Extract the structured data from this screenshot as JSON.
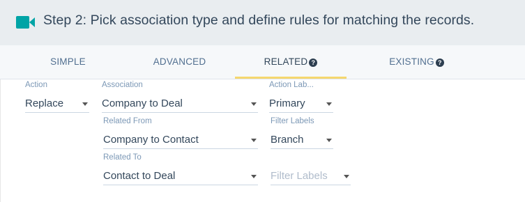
{
  "header": {
    "title": "Step 2: Pick association type and define rules for matching the records.",
    "icon": "video-camera-icon",
    "icon_color": "#00a4a6"
  },
  "tabs": [
    {
      "label": "SIMPLE",
      "active": false,
      "help": false
    },
    {
      "label": "ADVANCED",
      "active": false,
      "help": false
    },
    {
      "label": "RELATED",
      "active": true,
      "help": true
    },
    {
      "label": "EXISTING",
      "active": false,
      "help": true
    }
  ],
  "help_glyph": "?",
  "form": {
    "action": {
      "label": "Action",
      "value": "Replace"
    },
    "association": {
      "label": "Association",
      "value": "Company to Deal"
    },
    "action_labels": {
      "label": "Action Lab...",
      "value": "Primary"
    },
    "related_from": {
      "label": "Related From",
      "value": "Company to Contact"
    },
    "filter_labels_1": {
      "label": "Filter Labels",
      "value": "Branch"
    },
    "related_to": {
      "label": "Related To",
      "value": "Contact to Deal"
    },
    "filter_labels_2": {
      "placeholder": "Filter Labels"
    }
  },
  "colors": {
    "accent_underline": "#f5d76e",
    "header_bg": "#e9edf0",
    "text_primary": "#33475b"
  }
}
